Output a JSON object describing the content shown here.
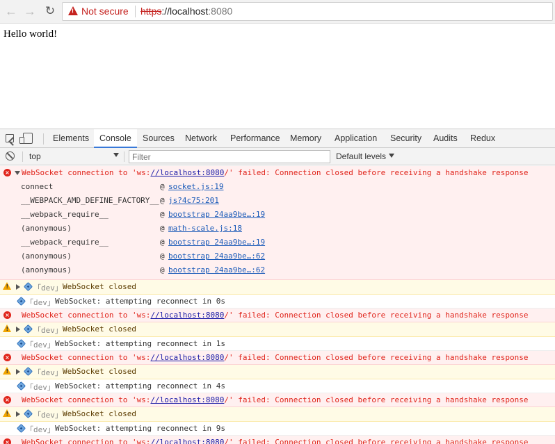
{
  "browser": {
    "not_secure": "Not secure",
    "url_scheme": "https",
    "url_sep": "://",
    "url_host": "localhost",
    "url_port": ":8080"
  },
  "page": {
    "body_text": "Hello world!"
  },
  "devtools": {
    "tabs": [
      "Elements",
      "Console",
      "Sources",
      "Network",
      "Performance",
      "Memory",
      "Application",
      "Security",
      "Audits",
      "Redux"
    ],
    "active_tab": "Console",
    "context": "top",
    "filter_placeholder": "Filter",
    "levels": "Default levels"
  },
  "console": {
    "error_prefix": "WebSocket connection to 'ws:",
    "error_url": "//localhost:8080",
    "error_suffix": "/' failed: Connection closed before receiving a handshake response",
    "stack": [
      {
        "fn": "connect",
        "src": "socket.js:19"
      },
      {
        "fn": "__WEBPACK_AMD_DEFINE_FACTORY__",
        "src": "js?4c75:201"
      },
      {
        "fn": "__webpack_require__",
        "src": "bootstrap 24aa9be…:19"
      },
      {
        "fn": "(anonymous)",
        "src": " math-scale.js:18"
      },
      {
        "fn": "__webpack_require__",
        "src": "bootstrap 24aa9be…:19"
      },
      {
        "fn": "(anonymous)",
        "src": "bootstrap 24aa9be…:62"
      },
      {
        "fn": "(anonymous)",
        "src": "bootstrap 24aa9be…:62"
      }
    ],
    "at_symbol": "@",
    "dev_tag": "「dev」",
    "closed_msg": "WebSocket closed",
    "reconnect_msgs": [
      "WebSocket: attempting reconnect in 0s",
      "WebSocket: attempting reconnect in 1s",
      "WebSocket: attempting reconnect in 4s",
      "WebSocket: attempting reconnect in 9s"
    ]
  }
}
